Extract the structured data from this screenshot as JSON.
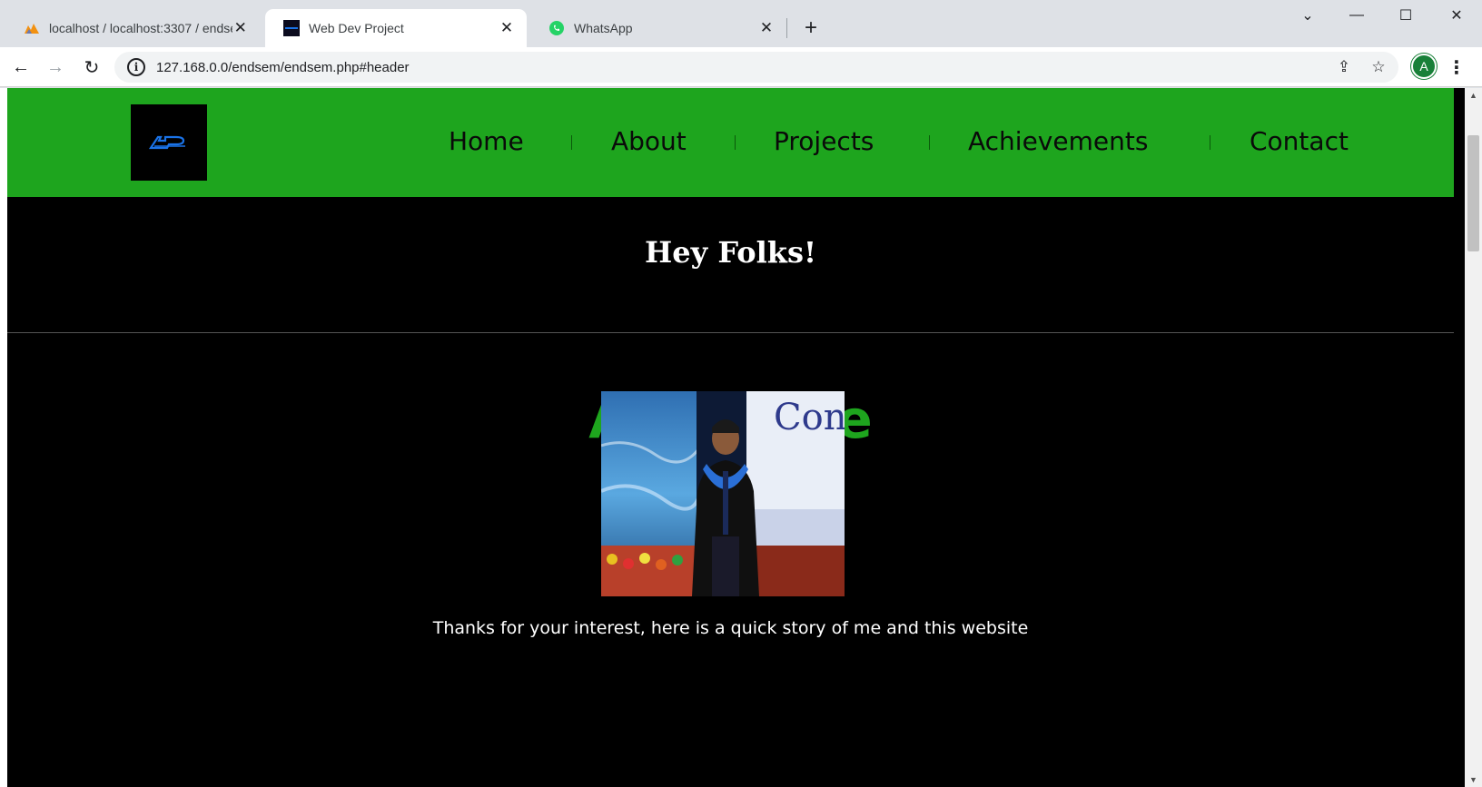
{
  "browser": {
    "tabs": [
      {
        "title": "localhost / localhost:3307 / endsem",
        "icon": "phpmyadmin-icon",
        "active": false
      },
      {
        "title": "Web Dev Project",
        "icon": "site-favicon",
        "active": true
      },
      {
        "title": "WhatsApp",
        "icon": "whatsapp-icon",
        "active": false
      }
    ],
    "url": "127.168.0.0/endsem/endsem.php#header",
    "profile_initial": "A"
  },
  "header": {
    "logo_text": "ACP",
    "nav": [
      "Home",
      "About",
      "Projects",
      "Achievements",
      "Contact"
    ]
  },
  "hero": {
    "title": "Hey Folks!"
  },
  "about": {
    "title": "About Me",
    "intro": "Thanks for your interest, here is a quick story of me and this website",
    "photo_sign_text": "Con"
  },
  "colors": {
    "header_green": "#1ea51e",
    "page_bg": "#000000",
    "title_green": "#1ea51e",
    "logo_blue": "#1a73e8"
  }
}
